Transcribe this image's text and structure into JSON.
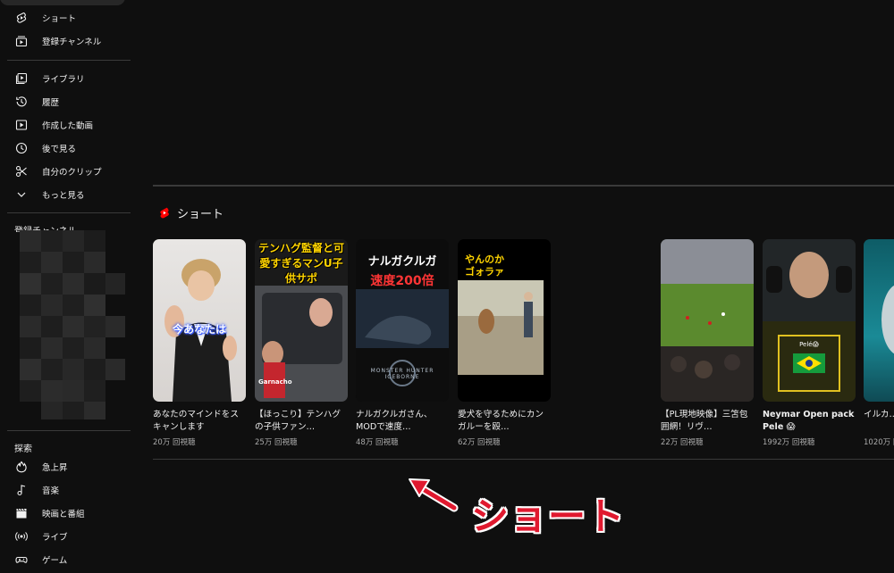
{
  "sidebar": {
    "items": [
      {
        "label": "ショート",
        "icon": "shorts-icon"
      },
      {
        "label": "登録チャンネル",
        "icon": "subscriptions-icon"
      },
      {
        "label": "ライブラリ",
        "icon": "library-icon"
      },
      {
        "label": "履歴",
        "icon": "history-icon"
      },
      {
        "label": "作成した動画",
        "icon": "your-videos-icon"
      },
      {
        "label": "後で見る",
        "icon": "watch-later-icon"
      },
      {
        "label": "自分のクリップ",
        "icon": "clips-icon"
      },
      {
        "label": "もっと見る",
        "icon": "chevron-down-icon"
      }
    ],
    "subscriptions_heading": "登録チャンネル",
    "explore_heading": "探索",
    "explore_items": [
      {
        "label": "急上昇",
        "icon": "trending-icon"
      },
      {
        "label": "音楽",
        "icon": "music-icon"
      },
      {
        "label": "映画と番組",
        "icon": "movies-icon"
      },
      {
        "label": "ライブ",
        "icon": "live-icon"
      },
      {
        "label": "ゲーム",
        "icon": "gaming-icon"
      }
    ]
  },
  "shorts": {
    "heading": "ショート",
    "cards": [
      {
        "title": "あなたのマインドをスキャンします",
        "views": "20万 回視聴",
        "thumb_text": "今あなたは"
      },
      {
        "title": "【ほっこり】テンハグの子供ファン…",
        "views": "25万 回視聴",
        "thumb_text": "テンハグ監督と可愛すぎるマンU子供サポ",
        "thumb_sub": "Garnacho"
      },
      {
        "title": "ナルガクルガさん、MODで速度…",
        "views": "48万 回視聴",
        "thumb_text": "ナルガクルガ",
        "thumb_text2": "速度200倍",
        "thumb_sub": "MONSTER HUNTER ICEBORNE"
      },
      {
        "title": "愛犬を守るためにカンガルーを殴…",
        "views": "62万 回視聴",
        "thumb_text": "やんのか",
        "thumb_text2": "ゴォラァ"
      },
      {
        "title": "【PL現地映像】三笘包囲網！リヴ…",
        "views": "22万 回視聴"
      },
      {
        "title": "Neymar Open pack Pele 😱",
        "views": "1992万 回視聴",
        "thumb_text": "Pelé😱"
      },
      {
        "title": "イルカ…やべぇ…",
        "views": "1020万 回"
      }
    ]
  },
  "annotation": {
    "text": "ショート"
  },
  "colors": {
    "background": "#0f0f0f",
    "text": "#f1f1f1",
    "muted": "#aaaaaa",
    "shorts_red": "#ff0000",
    "annotation_red": "#e0192f"
  }
}
